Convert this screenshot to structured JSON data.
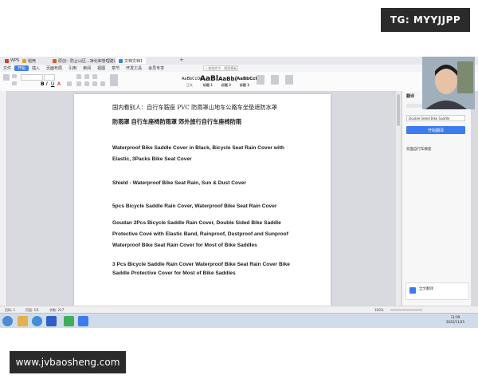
{
  "watermark": {
    "tag": "TG: MYYJJPP",
    "website": "www.jvbaosheng.com"
  },
  "tabs": [
    {
      "label": "稻壳",
      "color": "#e0a020"
    },
    {
      "label": "原创：防止山区...净化和管理建议",
      "color": "#e05a2a"
    },
    {
      "label": "文档文档1",
      "color": "#3d7cf0"
    }
  ],
  "menu": {
    "items": [
      "文件",
      "开始",
      "插入",
      "页面布局",
      "引用",
      "审阅",
      "视图",
      "章节",
      "开发工具",
      "会员专享"
    ],
    "active_index": 1,
    "search_placeholder": "查找命令、搜索模板"
  },
  "styles": [
    {
      "sample": "AaBbCcDd",
      "name": "正文"
    },
    {
      "sample": "AaBl",
      "name": "标题 1"
    },
    {
      "sample": "AaBb(",
      "name": "标题 2"
    },
    {
      "sample": "AaBbCcI",
      "name": "标题 3"
    }
  ],
  "document": {
    "lines": [
      {
        "text": "国内看别人：自行车鞍座 PVC 防雨罩山地车公路车坐垫遮防水罩",
        "cn": true
      },
      {
        "text": "防雨罩 自行车座椅防雨罩 郊外旅行自行车座椅防雨",
        "cn": true
      },
      {
        "text": "Waterproof Bike Saddle Cover in Black, Bicycle Seat Rain Cover with"
      },
      {
        "text": "Elastic, 3Packs Bike Seat Cover"
      },
      {
        "text": "Shield - Waterproof Bike Seat Rain, Sun & Dust Cover"
      },
      {
        "text": "5pcs Bicycle Saddle Rain Cover, Waterproof Bike Seat Rain Cover"
      },
      {
        "text": "Goudan 2Pcs Bicycle Saddle Rain Cover, Double Sided Bike Saddle"
      },
      {
        "text": "Protective Cové with Elastic Band, Rainproof, Dustproof and Sunproof"
      },
      {
        "text": "Waterproof Bike Seat Rain Cover for Most of Bike Saddles"
      },
      {
        "text": "3 Pcs Bicycle Saddle Rain Cover Waterproof Bike Seat Rain Cover Bike"
      },
      {
        "text": "Saddle Protective Cover for Most of Bike Saddles"
      }
    ]
  },
  "translate_panel": {
    "title": "翻译",
    "source_text": "Double Sided Bike Saddle",
    "button_label": "开始翻译",
    "result_label": "双面自行车鞍座",
    "footer_label": "全文翻译"
  },
  "statusbar": {
    "page": "页码: 1",
    "pages": "页面: 1/1",
    "words": "字数: 217",
    "zoom": "100%"
  },
  "clock": {
    "time": "11:09",
    "date": "2022/11/25"
  },
  "colors": {
    "accent": "#3d7cf0",
    "page_bg": "#ffffff",
    "workspace": "#d9dadf"
  }
}
